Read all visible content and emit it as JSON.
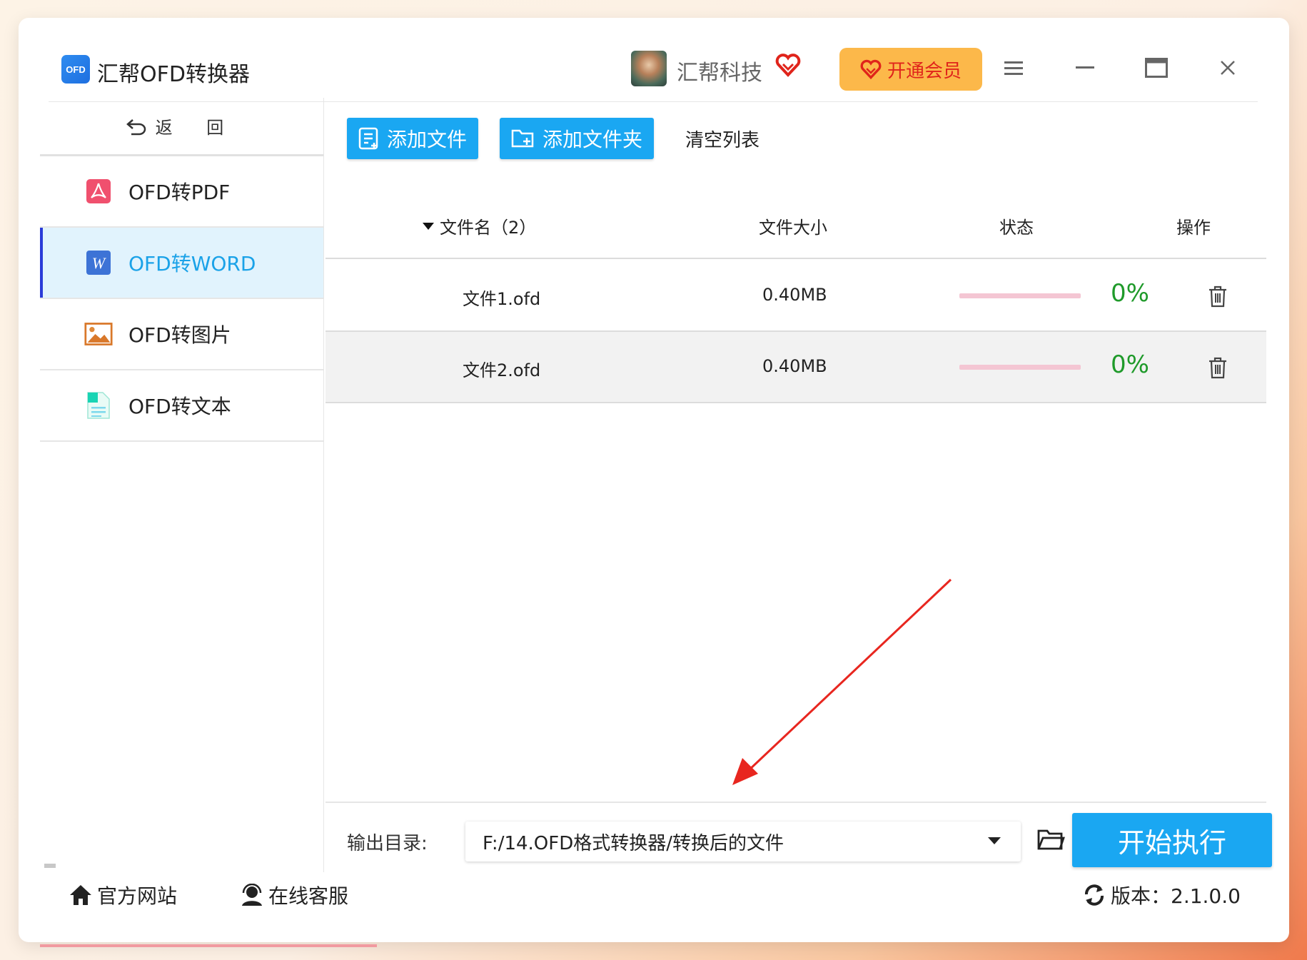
{
  "app": {
    "logo_text": "OFD",
    "title": "汇帮OFD转换器"
  },
  "account": {
    "name": "汇帮科技",
    "vip_button": "开通会员"
  },
  "sidebar": {
    "back_label": "返 回",
    "items": [
      {
        "label": "OFD转PDF",
        "icon": "pdf-icon",
        "active": false
      },
      {
        "label": "OFD转WORD",
        "icon": "word-icon",
        "active": true
      },
      {
        "label": "OFD转图片",
        "icon": "image-icon",
        "active": false
      },
      {
        "label": "OFD转文本",
        "icon": "text-file-icon",
        "active": false
      }
    ]
  },
  "toolbar": {
    "add_file": "添加文件",
    "add_folder": "添加文件夹",
    "clear_list": "清空列表"
  },
  "table": {
    "headers": {
      "name": "文件名（2）",
      "size": "文件大小",
      "status": "状态",
      "action": "操作"
    },
    "rows": [
      {
        "name": "文件1.ofd",
        "size": "0.40MB",
        "progress": 0,
        "percent": "0%"
      },
      {
        "name": "文件2.ofd",
        "size": "0.40MB",
        "progress": 0,
        "percent": "0%"
      }
    ]
  },
  "output": {
    "label": "输出目录:",
    "path": "F:/14.OFD格式转换器/转换后的文件",
    "start_button": "开始执行"
  },
  "footer": {
    "website": "官方网站",
    "support": "在线客服",
    "version": "版本：2.1.0.0"
  },
  "colors": {
    "accent": "#1aa7f2",
    "vip": "#fcb84a",
    "active_nav_bg": "#e1f3fd",
    "percent_text": "#1f9a2a",
    "annotation_arrow": "#e8261f"
  }
}
